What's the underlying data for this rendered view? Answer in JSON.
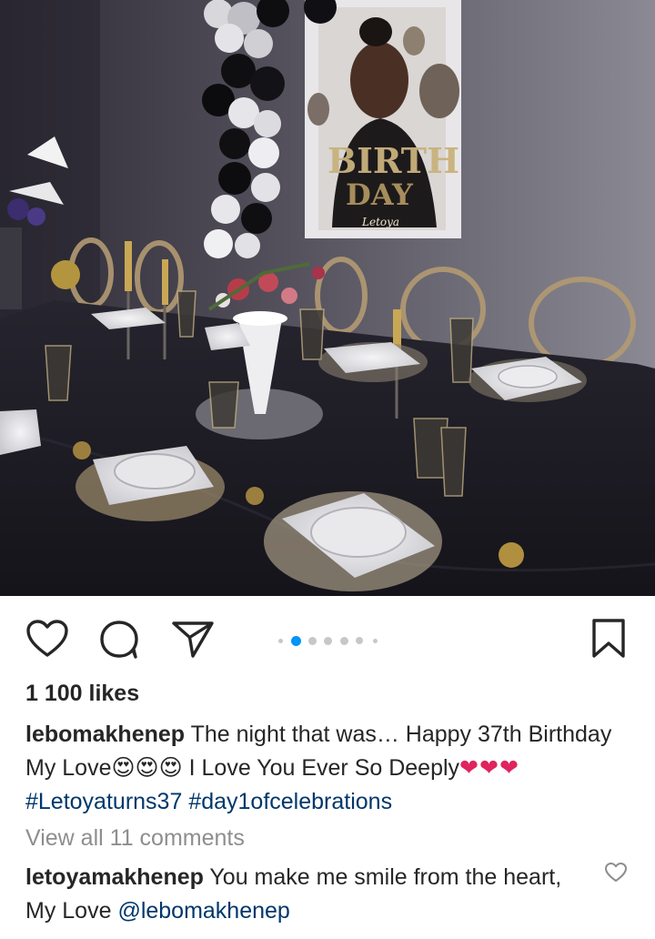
{
  "post": {
    "image_alt": "Birthday dinner table setting with balloons and birthday poster",
    "poster_text": "Letoya",
    "carousel": {
      "total": 7,
      "active_index": 1
    },
    "likes_label": "1 100 likes",
    "caption": {
      "username": "lebomakhenep",
      "text_1": "The night that was… Happy 37th Birthday My Love",
      "emoji_faces": "😍😍😍",
      "text_2": " I Love You Ever So Deeply",
      "hearts": "❤❤❤",
      "hashtag_1": "#Letoyaturns37",
      "hashtag_2": "#day1ofcelebrations"
    },
    "view_comments_label": "View all 11 comments",
    "comment": {
      "username": "letoyamakhenep",
      "text": "You make me smile from the heart, My Love",
      "mention": "@lebomakhenep"
    }
  },
  "icons": {
    "like": "heart-outline-icon",
    "comment": "speech-bubble-icon",
    "share": "paper-plane-icon",
    "save": "bookmark-icon",
    "comment_like": "small-heart-icon"
  },
  "colors": {
    "text": "#262626",
    "muted": "#8e8e8e",
    "link": "#00376b",
    "carousel_active": "#0095f6",
    "heart": "#e0245e"
  }
}
